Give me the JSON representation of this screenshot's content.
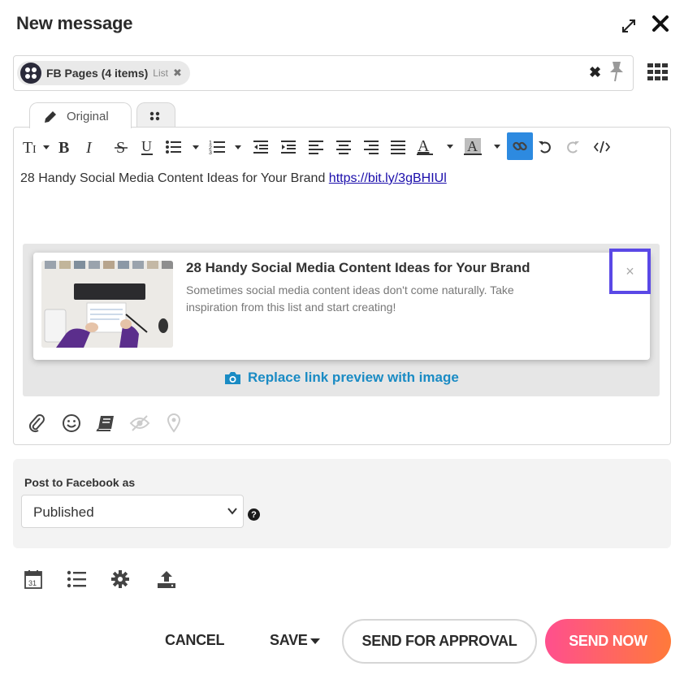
{
  "dialog": {
    "title": "New message"
  },
  "recipients": {
    "chip_label": "FB Pages (4 items)",
    "chip_sub": "List",
    "chip_remove": "✖",
    "clear": "✖"
  },
  "tabs": {
    "original_label": "Original"
  },
  "editor": {
    "text": "28 Handy Social Media Content Ideas for Your Brand ",
    "link": "https://bit.ly/3gBHIUl",
    "toolbar": [
      "text-size-icon",
      "bold-icon",
      "italic-icon",
      "strikethrough-icon",
      "underline-icon",
      "bullet-list-icon",
      "numbered-list-icon",
      "outdent-icon",
      "indent-icon",
      "align-left-icon",
      "align-center-icon",
      "align-right-icon",
      "justify-icon",
      "font-color-icon",
      "highlight-color-icon",
      "link-icon",
      "undo-icon",
      "redo-icon",
      "code-view-icon"
    ]
  },
  "link_preview": {
    "title": "28 Handy Social Media Content Ideas for Your Brand",
    "description": "Sometimes social media content ideas don't come naturally. Take inspiration from this list and start creating!",
    "close": "×",
    "replace_label": "Replace link preview with image"
  },
  "post_settings": {
    "label": "Post to Facebook as",
    "selected": "Published",
    "help": "?"
  },
  "footer": {
    "cancel": "CANCEL",
    "save": "SAVE",
    "send_for_approval": "SEND FOR APPROVAL",
    "send_now": "SEND NOW"
  },
  "colors": {
    "accent_link": "#1a8bc4",
    "active_tool": "#2d8ae0",
    "focus_outline": "#5a48e6",
    "send_gradient_start": "#ff4f8e",
    "send_gradient_end": "#ff7a3a"
  }
}
